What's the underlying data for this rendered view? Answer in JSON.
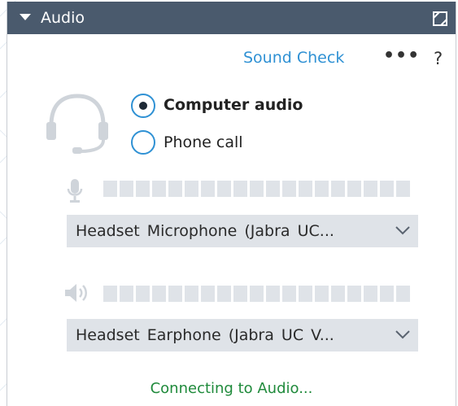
{
  "panel": {
    "title": "Audio",
    "sound_check_label": "Sound Check",
    "more_label": "•••",
    "help_label": "?"
  },
  "audio_mode": {
    "options": [
      {
        "label": "Computer audio",
        "selected": true
      },
      {
        "label": "Phone call",
        "selected": false
      }
    ]
  },
  "microphone": {
    "device": "Headset Microphone (Jabra UC...",
    "level": 0
  },
  "speaker": {
    "device": "Headset Earphone (Jabra UC V...",
    "level": 0
  },
  "status_text": "Connecting to Audio...",
  "icons": {
    "collapse": "caret-down-icon",
    "popout": "popout-window-icon",
    "headset": "headset-icon",
    "microphone": "microphone-icon",
    "speaker": "speaker-icon",
    "dropdown": "chevron-down-icon"
  },
  "colors": {
    "titlebar": "#4a5a6d",
    "link": "#2f91d4",
    "status": "#1f8a3b",
    "meter": "#dfe3e8"
  }
}
